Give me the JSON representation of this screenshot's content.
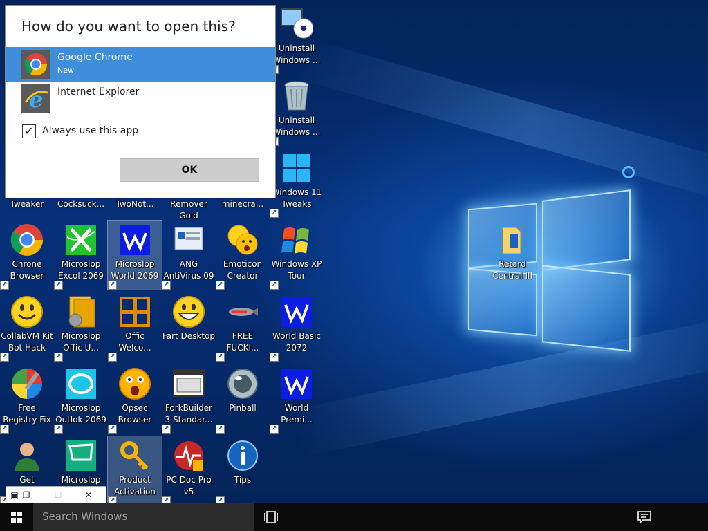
{
  "dialog": {
    "title": "How do you want to open this?",
    "apps": [
      {
        "name": "Google Chrome",
        "subtitle": "New",
        "icon": "chrome-icon",
        "selected": true
      },
      {
        "name": "Internet Explorer",
        "subtitle": "",
        "icon": "internet-explorer-icon",
        "selected": false
      }
    ],
    "always_use": {
      "label": "Always use this app",
      "checked": true
    },
    "ok_label": "OK"
  },
  "desktop": {
    "column1": [
      {
        "label": "Tweaker"
      },
      {
        "label": "Chrone\nBrowser",
        "icon": "chrome-icon"
      },
      {
        "label": "CollabVM Kit\nBot Hack",
        "icon": "smiley-icon"
      },
      {
        "label": "Free\nRegistry Fix",
        "icon": "registry-fix-icon"
      },
      {
        "label": "Get",
        "icon": "person-icon"
      }
    ],
    "column2": [
      {
        "label": "Cocksuck..."
      },
      {
        "label": "Microslop\nExcol 2069",
        "icon": "excol-icon"
      },
      {
        "label": "Microslop\nOffic U...",
        "icon": "office-update-icon"
      },
      {
        "label": "Microslop\nOutlok 2069",
        "icon": "outlook-icon"
      },
      {
        "label": "Microslop",
        "icon": "microslop-icon"
      }
    ],
    "column3": [
      {
        "label": "TwoNot..."
      },
      {
        "label": "Microslop\nWorld 2069",
        "icon": "world-icon",
        "selected": true
      },
      {
        "label": "Offic\nWelco...",
        "icon": "office-welcome-icon"
      },
      {
        "label": "Opsec\nBrowser",
        "icon": "surprised-face-icon"
      },
      {
        "label": "Product\nActivation",
        "icon": "key-icon",
        "selected": true
      }
    ],
    "column4": [
      {
        "label": "Remover Gold"
      },
      {
        "label": "ANG\nAntiVirus 09",
        "icon": "antivirus-icon"
      },
      {
        "label": "Fart Desktop",
        "icon": "grin-face-icon"
      },
      {
        "label": "ForkBuilder\n3 Standar...",
        "icon": "window-app-icon"
      },
      {
        "label": "PC Doc Pro\nv5",
        "icon": "pc-doc-icon"
      }
    ],
    "column5": [
      {
        "label": "minecra..."
      },
      {
        "label": "Emoticon\nCreator",
        "icon": "emoticon-icon"
      },
      {
        "label": "FREE\nFUCKI...",
        "icon": "fish-icon"
      },
      {
        "label": "Pinball",
        "icon": "pinball-icon"
      },
      {
        "label": "Tips",
        "icon": "info-icon"
      }
    ],
    "column6": [
      {
        "label": "Uninstall\nWindows ...",
        "icon": "computer-cd-icon"
      },
      {
        "label": "Uninstall\nWindows ...",
        "icon": "trash-can-icon"
      },
      {
        "label": "Windows 11\nTweaks",
        "icon": "windows-logo-icon"
      },
      {
        "label": "Windows XP\nTour",
        "icon": "windows-xp-flag-icon"
      },
      {
        "label": "World Basic\n2072",
        "icon": "world-icon"
      },
      {
        "label": "World\nPremi...",
        "icon": "world-icon"
      }
    ],
    "retard": {
      "label": "Retard\nCentral III",
      "icon": "folder-icon"
    }
  },
  "taskbar": {
    "search_placeholder": "Search Windows",
    "start_icon": "windows-start-icon",
    "task_view_icon": "task-view-icon",
    "action_center_icon": "action-center-icon"
  },
  "colors": {
    "selection": "#3e8edc",
    "taskbar": "#0b0b0b",
    "search": "#2a2a2a"
  }
}
